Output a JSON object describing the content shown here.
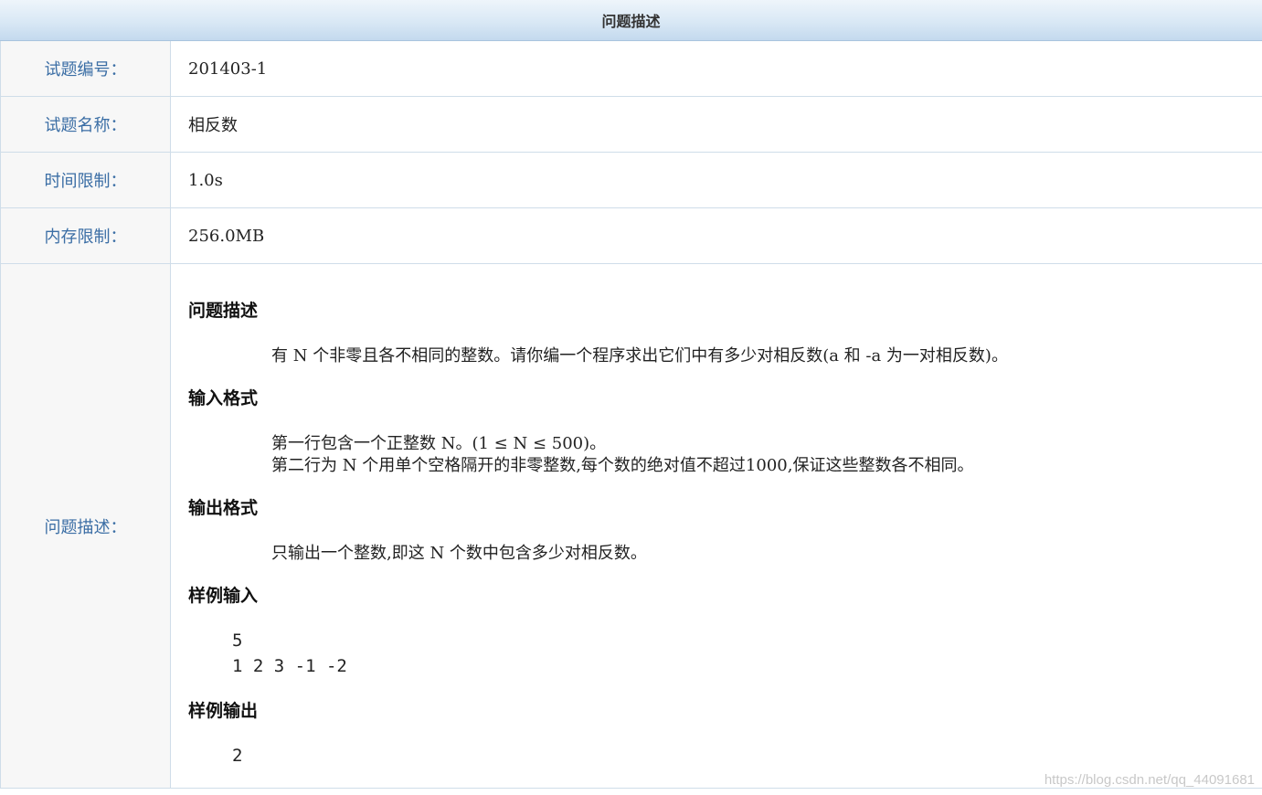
{
  "header": {
    "title": "问题描述"
  },
  "rows": [
    {
      "label": "试题编号：",
      "value": "201403-1"
    },
    {
      "label": "试题名称：",
      "value": "相反数"
    },
    {
      "label": "时间限制：",
      "value": "1.0s"
    },
    {
      "label": "内存限制：",
      "value": "256.0MB"
    }
  ],
  "problem": {
    "label": "问题描述：",
    "description": {
      "title": "问题描述",
      "text": "有 N 个非零且各不相同的整数。请你编一个程序求出它们中有多少对相反数(a 和 -a 为一对相反数)。"
    },
    "input_format": {
      "title": "输入格式",
      "line1": "第一行包含一个正整数 N。(1 ≤ N ≤ 500)。",
      "line2": "第二行为 N 个用单个空格隔开的非零整数,每个数的绝对值不超过1000,保证这些整数各不相同。"
    },
    "output_format": {
      "title": "输出格式",
      "text": "只输出一个整数,即这 N 个数中包含多少对相反数。"
    },
    "sample_input": {
      "title": "样例输入",
      "line1": "5",
      "line2": "1 2 3 -1 -2"
    },
    "sample_output": {
      "title": "样例输出",
      "line1": "2"
    }
  },
  "watermark": "https://blog.csdn.net/qq_44091681"
}
